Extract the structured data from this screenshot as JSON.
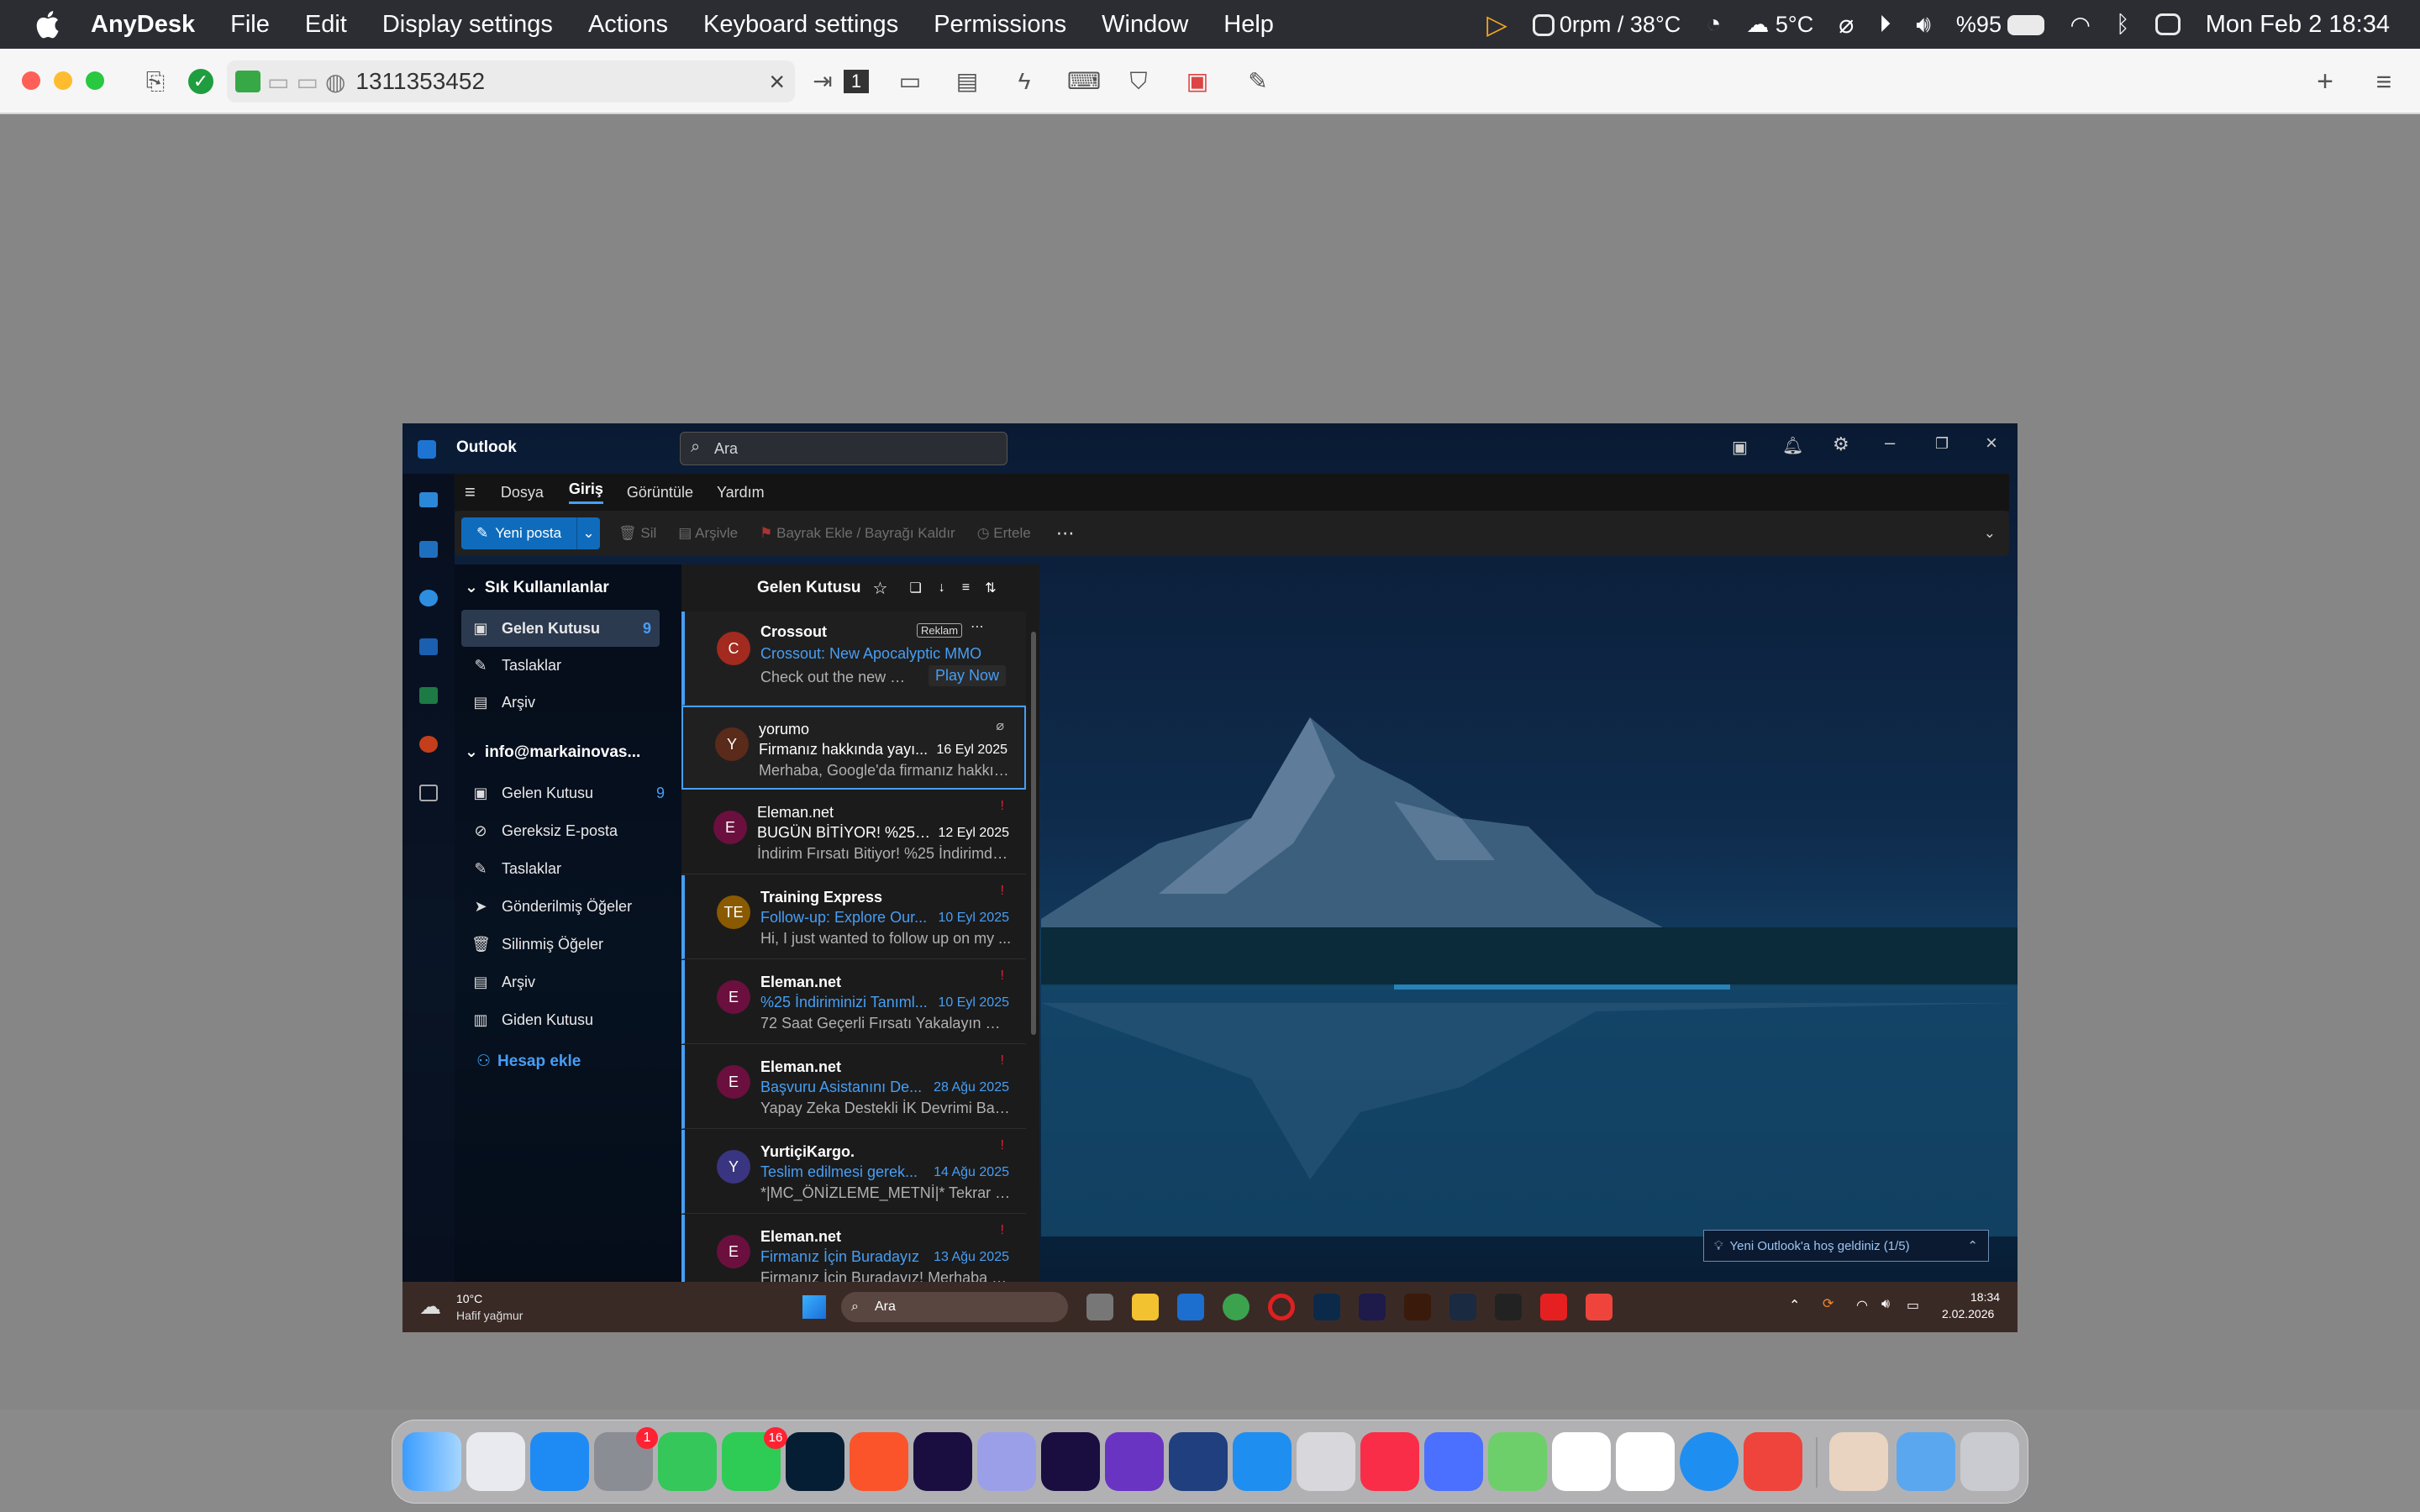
{
  "menubar": {
    "app": "AnyDesk",
    "items": [
      "File",
      "Edit",
      "Display settings",
      "Actions",
      "Keyboard settings",
      "Permissions",
      "Window",
      "Help"
    ],
    "fan": "0rpm / 38°C",
    "weather": "5°C",
    "battery": "%95",
    "datetime": "Mon Feb 2  18:34"
  },
  "anydesk": {
    "address": "1311353452"
  },
  "outlook": {
    "title": "Outlook",
    "search_placeholder": "Ara",
    "tabs": [
      "Dosya",
      "Giriş",
      "Görüntüle",
      "Yardım"
    ],
    "new_mail": "Yeni posta",
    "actions": [
      "Sil",
      "Arşivle",
      "Bayrak Ekle / Bayrağı Kaldır",
      "Ertele"
    ],
    "favorites_title": "Sık Kullanılanlar",
    "favorites": [
      {
        "label": "Gelen Kutusu",
        "count": "9"
      },
      {
        "label": "Taslaklar",
        "count": ""
      },
      {
        "label": "Arşiv",
        "count": ""
      }
    ],
    "account": "info@markainovas...",
    "account_folders": [
      {
        "label": "Gelen Kutusu",
        "count": "9"
      },
      {
        "label": "Gereksiz E-posta",
        "count": ""
      },
      {
        "label": "Taslaklar",
        "count": ""
      },
      {
        "label": "Gönderilmiş Öğeler",
        "count": ""
      },
      {
        "label": "Silinmiş Öğeler",
        "count": ""
      },
      {
        "label": "Arşiv",
        "count": ""
      },
      {
        "label": "Giden Kutusu",
        "count": ""
      }
    ],
    "add_account": "Hesap ekle",
    "list_title": "Gelen Kutusu",
    "ad": {
      "avatar": "C",
      "sender": "Crossout",
      "badge": "Reklam",
      "subject": "Crossout: New Apocalyptic MMO",
      "preview": "Check out the new Cr...",
      "cta": "Play Now"
    },
    "emails": [
      {
        "avatar": "Y",
        "color": "#5a2a1a",
        "sender": "yorumo",
        "subject": "Firmanız hakkında yayı...",
        "date": "16 Eyl 2025",
        "preview": "Merhaba, Google'da firmanız hakkın...",
        "unread": false
      },
      {
        "avatar": "E",
        "color": "#6b0f3e",
        "sender": "Eleman.net",
        "subject": "BUGÜN BİTİYOR! %25 İ...",
        "date": "12 Eyl 2025",
        "preview": "İndirim Fırsatı Bitiyor! %25 İndirimde...",
        "unread": false
      },
      {
        "avatar": "TE",
        "color": "#8a5a00",
        "sender": "Training Express",
        "subject": "Follow-up: Explore Our...",
        "date": "10 Eyl 2025",
        "preview": "Hi, I just wanted to follow up on my ...",
        "unread": true
      },
      {
        "avatar": "E",
        "color": "#6b0f3e",
        "sender": "Eleman.net",
        "subject": "%25 İndiriminizi Tanıml...",
        "date": "10 Eyl 2025",
        "preview": "72 Saat Geçerli Fırsatı Yakalayın %25...",
        "unread": true
      },
      {
        "avatar": "E",
        "color": "#6b0f3e",
        "sender": "Eleman.net",
        "subject": "Başvuru Asistanını De...",
        "date": "28 Ağu 2025",
        "preview": "Yapay Zeka Destekli İK Devrimi Başla...",
        "unread": true
      },
      {
        "avatar": "Y",
        "color": "#3a3580",
        "sender": "YurtiçiKargo.",
        "subject": "Teslim edilmesi gerek...",
        "date": "14 Ağu 2025",
        "preview": "*|MC_ÖNİZLEME_METNİ|* Tekrar tesl...",
        "unread": true
      },
      {
        "avatar": "E",
        "color": "#6b0f3e",
        "sender": "Eleman.net",
        "subject": "Firmanız İçin Buradayız",
        "date": "13 Ağu 2025",
        "preview": "Firmanız İçin Buradayız! Merhaba Ze...",
        "unread": true
      }
    ],
    "welcome": "Yeni Outlook'a hoş geldiniz (1/5)"
  },
  "taskbar": {
    "temp": "10°C",
    "weather": "Hafif yağmur",
    "search": "Ara",
    "time": "18:34",
    "date": "2.02.2026"
  },
  "dock": {
    "badge_settings": "1",
    "badge_whatsapp": "16"
  }
}
